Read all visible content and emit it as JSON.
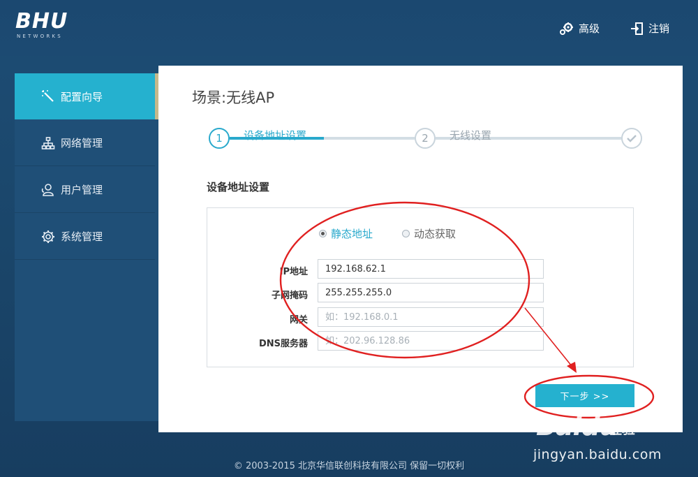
{
  "header": {
    "logo_text": "BHU",
    "logo_sub": "NETWORKS",
    "advanced_label": "高级",
    "logout_label": "注销"
  },
  "sidebar": {
    "items": [
      {
        "label": "配置向导",
        "icon": "magic-wand-icon",
        "active": true
      },
      {
        "label": "网络管理",
        "icon": "network-icon",
        "active": false
      },
      {
        "label": "用户管理",
        "icon": "users-icon",
        "active": false
      },
      {
        "label": "系统管理",
        "icon": "gear-icon",
        "active": false
      }
    ]
  },
  "main": {
    "scene_title": "场景:无线AP",
    "steps": [
      {
        "number": "1",
        "label": "设备地址设置",
        "active": true
      },
      {
        "number": "2",
        "label": "无线设置",
        "active": false
      },
      {
        "number": "",
        "label": "",
        "icon": "check-icon",
        "active": false
      }
    ],
    "section_title": "设备地址设置",
    "mode_options": [
      {
        "label": "静态地址",
        "selected": true
      },
      {
        "label": "动态获取",
        "selected": false
      }
    ],
    "fields": [
      {
        "label": "IP地址",
        "value": "192.168.62.1",
        "placeholder": ""
      },
      {
        "label": "子网掩码",
        "value": "255.255.255.0",
        "placeholder": ""
      },
      {
        "label": "网关",
        "value": "",
        "placeholder": "如：192.168.0.1"
      },
      {
        "label": "DNS服务器",
        "value": "",
        "placeholder": "如：202.96.128.86"
      }
    ],
    "next_button_label": "下一步 >>"
  },
  "footer": {
    "copyright": "© 2003-2015 北京华信联创科技有限公司 保留一切权利"
  },
  "watermark": {
    "brand": "Baidu",
    "sub": "经验",
    "url": "jingyan.baidu.com"
  },
  "colors": {
    "accent": "#25b1cf",
    "background": "#1c4a72",
    "annotation": "#e02020"
  }
}
